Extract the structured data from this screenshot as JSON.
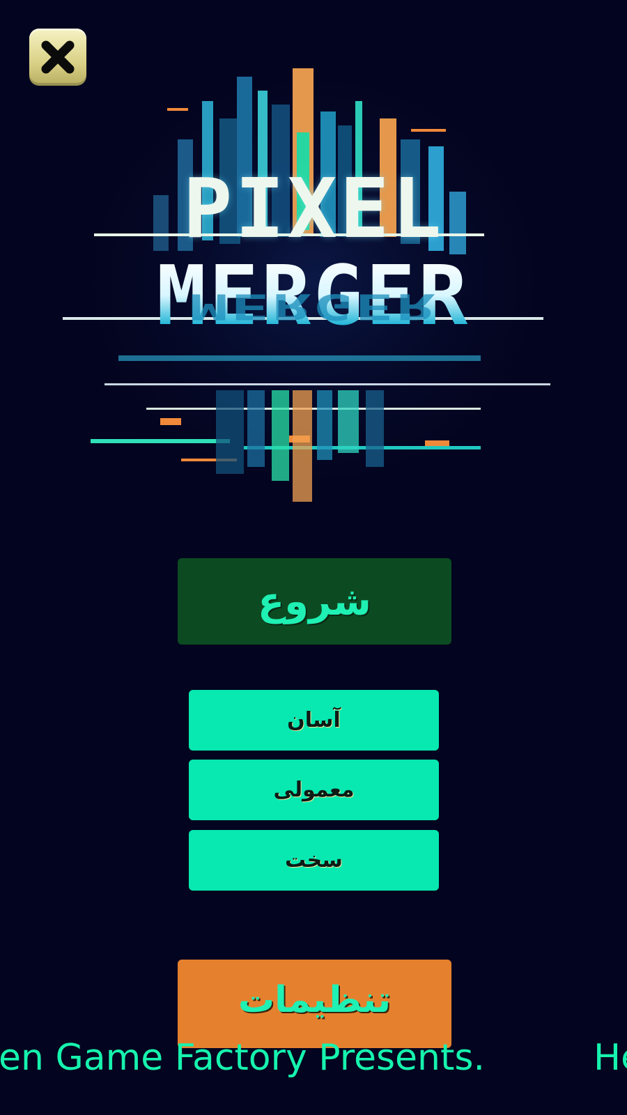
{
  "close_button": {
    "icon": "close-icon"
  },
  "logo": {
    "line1": "PIXEL",
    "line2": "MERGER",
    "line3": "MERGER"
  },
  "menu": {
    "start_label": "شروع",
    "difficulty": {
      "easy_label": "آسان",
      "normal_label": "معمولی",
      "hard_label": "سخت"
    },
    "settings_label": "تنظیمات"
  },
  "ticker": {
    "text_a": "en Game Factory Presents.",
    "text_b": "He"
  },
  "colors": {
    "background": "#03041f",
    "start_button": "#0c4b22",
    "difficulty_button": "#07e9b0",
    "settings_button": "#e5812e",
    "accent_text": "#16f3ae",
    "close_button": "#e6df9e"
  }
}
